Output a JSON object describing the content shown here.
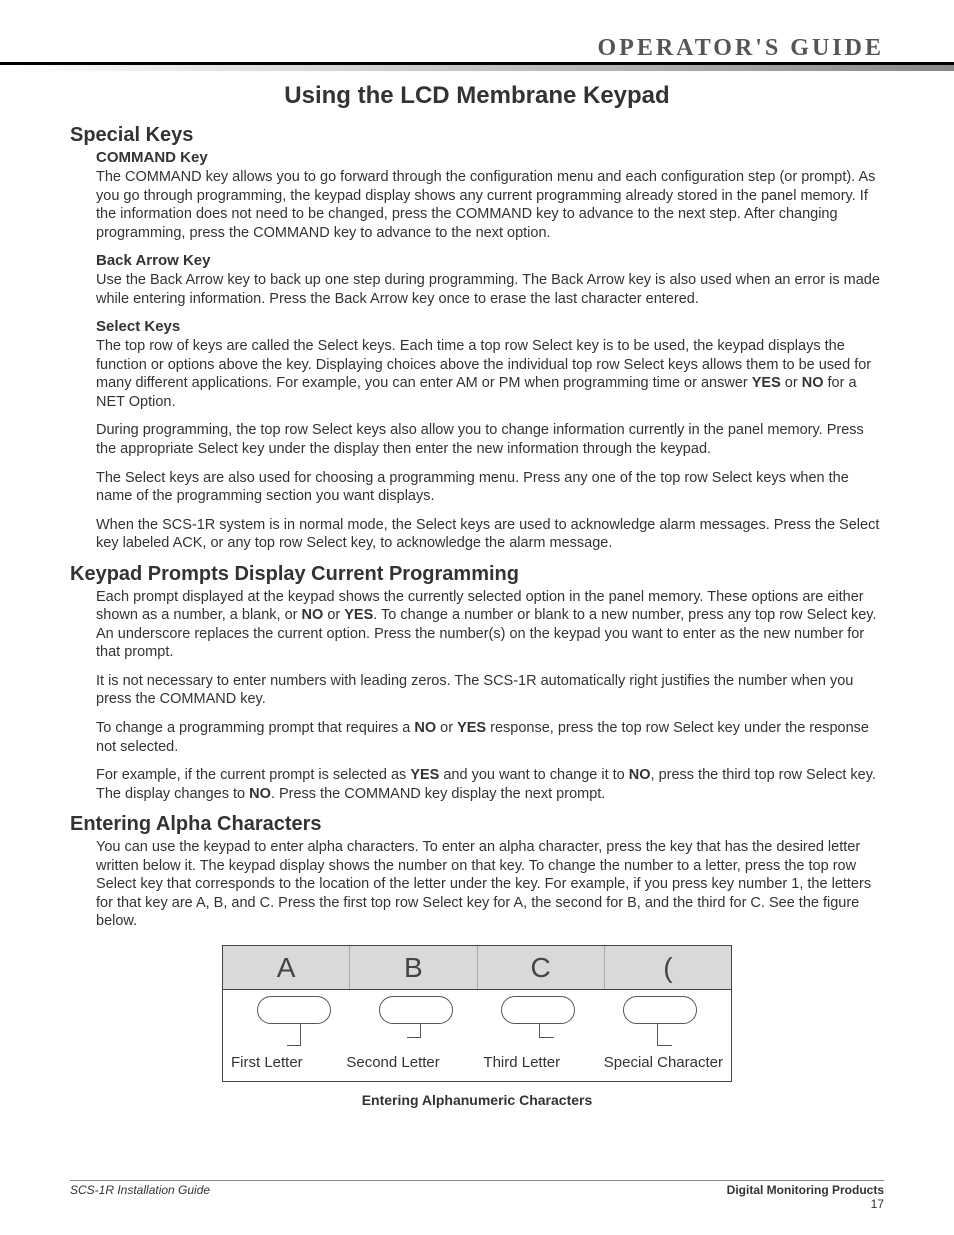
{
  "header": {
    "guide": "OPERATOR'S GUIDE"
  },
  "title": "Using the LCD Membrane Keypad",
  "sections": {
    "special_keys": {
      "heading": "Special Keys",
      "command": {
        "title": "COMMAND Key",
        "text": "The COMMAND key allows you to go forward through the configuration menu and each configuration step (or prompt).  As you go through programming, the keypad display shows any current programming already stored in the panel memory.  If the information does not need to be changed, press the COMMAND key to advance to the next step.  After changing programming, press the COMMAND key to advance to the next option."
      },
      "back_arrow": {
        "title": "Back Arrow Key",
        "text": "Use the Back Arrow key to back up one step during programming.  The Back Arrow key is also used when an error is made while entering information.  Press the Back Arrow key once to erase the last character entered."
      },
      "select_keys": {
        "title": "Select Keys",
        "p1_a": "The top row of keys are called the Select keys.  Each time a top row Select key is to be used, the keypad displays the function or options above the key.  Displaying choices above the individual top row Select keys allows them to be used for many different applications.  For example, you can enter AM or PM when programming time or answer ",
        "p1_yes": "YES",
        "p1_or": " or ",
        "p1_no": "NO",
        "p1_b": " for a NET Option.",
        "p2": "During programming, the top row Select keys also allow you to change information currently in the panel memory.  Press the appropriate Select key under the display then enter the new information through the keypad.",
        "p3": "The Select keys are also used for choosing a programming menu.  Press any one of the top row Select keys when the name of the programming section you want displays.",
        "p4": "When the SCS-1R system is in normal mode, the Select keys are used to acknowledge alarm messages.  Press the Select key labeled ACK, or any top row Select key, to acknowledge the alarm message."
      }
    },
    "keypad_prompts": {
      "heading": "Keypad Prompts Display Current Programming",
      "p1_a": "Each prompt displayed at the keypad shows the currently selected option in the panel memory.  These options are either shown as a number, a blank, or ",
      "p1_no": "NO",
      "p1_or": " or ",
      "p1_yes": "YES",
      "p1_b": ".  To change a number or blank to a new number, press any top row Select key.  An underscore replaces the current option.  Press the number(s) on the keypad you want to enter as the new number for that prompt.",
      "p2": "It is not necessary to enter numbers with leading zeros.  The SCS-1R automatically right justifies the number when you press the COMMAND key.",
      "p3_a": "To change a programming prompt that requires a ",
      "p3_no": "NO",
      "p3_or": " or ",
      "p3_yes": "YES",
      "p3_b": " response, press the top row Select key under the response not selected.",
      "p4_a": "For example, if the current prompt is selected as ",
      "p4_yes": "YES",
      "p4_mid": " and you want to change it to ",
      "p4_no": "NO",
      "p4_b": ", press the third top row Select key.  The display changes to ",
      "p4_no2": "NO",
      "p4_c": ".  Press the COMMAND key display the next prompt."
    },
    "alpha": {
      "heading": "Entering Alpha Characters",
      "p1": "You can use the keypad to enter alpha characters.  To enter an alpha character, press the key that has the desired letter written below it.  The keypad display shows the number on that key.  To change the number to a letter, press the top row Select key that corresponds to the location of the letter under the key.  For example, if you press key number 1, the letters for that key are A, B, and C.  Press the first top row Select key for A, the second for B, and the third for C.  See the figure below."
    }
  },
  "figure": {
    "lcd": [
      "A",
      "B",
      "C",
      "("
    ],
    "labels": [
      "First Letter",
      "Second Letter",
      "Third Letter",
      "Special Character"
    ],
    "caption": "Entering Alphanumeric Characters"
  },
  "footer": {
    "left": "SCS-1R Installation Guide",
    "right": "Digital Monitoring Products",
    "page": "17"
  }
}
